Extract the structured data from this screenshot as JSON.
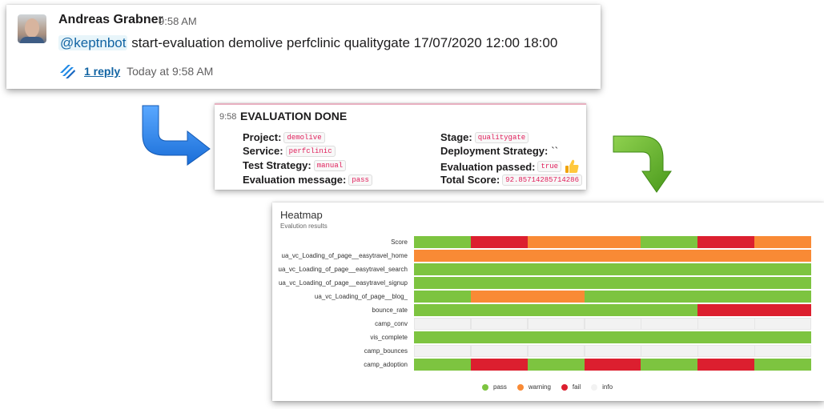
{
  "message": {
    "author": "Andreas Grabner",
    "time": "9:58 AM",
    "mention": "@keptnbot",
    "command": " start-evaluation demolive perfclinic qualitygate 17/07/2020 12:00 18:00",
    "reply_count": "1 reply",
    "reply_time": "Today at 9:58 AM"
  },
  "evaluation": {
    "time": "9:58",
    "title": "EVALUATION DONE",
    "project_label": "Project:",
    "project_value": "demolive",
    "service_label": "Service:",
    "service_value": "perfclinic",
    "test_strategy_label": "Test Strategy:",
    "test_strategy_value": "manual",
    "eval_message_label": "Evaluation message:",
    "eval_message_value": "pass",
    "stage_label": "Stage:",
    "stage_value": "qualitygate",
    "deployment_label": "Deployment Strategy:",
    "deployment_value": "``",
    "passed_label": "Evaluation passed:",
    "passed_value": "true",
    "score_label": "Total Score:",
    "score_value": "92.85714285714286"
  },
  "heatmap": {
    "title": "Heatmap",
    "subtitle": "Evalution results",
    "colors": {
      "pass": "#7dc440",
      "warning": "#f98a35",
      "fail": "#dc1f2f",
      "info": "#f2f2f2"
    },
    "legend": [
      {
        "key": "pass",
        "label": "pass"
      },
      {
        "key": "warning",
        "label": "warning"
      },
      {
        "key": "fail",
        "label": "fail"
      },
      {
        "key": "info",
        "label": "info"
      }
    ],
    "rows": [
      {
        "label": "Score",
        "cells": [
          "pass",
          "fail",
          "warning",
          "warning",
          "pass",
          "fail",
          "warning"
        ]
      },
      {
        "label": "ua_vc_Loading_of_page__easytravel_home",
        "cells": [
          "warning",
          "warning",
          "warning",
          "warning",
          "warning",
          "warning",
          "warning"
        ]
      },
      {
        "label": "ua_vc_Loading_of_page__easytravel_search",
        "cells": [
          "pass",
          "pass",
          "pass",
          "pass",
          "pass",
          "pass",
          "pass"
        ]
      },
      {
        "label": "ua_vc_Loading_of_page__easytravel_signup",
        "cells": [
          "pass",
          "pass",
          "pass",
          "pass",
          "pass",
          "pass",
          "pass"
        ]
      },
      {
        "label": "ua_vc_Loading_of_page__blog_",
        "cells": [
          "pass",
          "warning",
          "warning",
          "pass",
          "pass",
          "pass",
          "pass"
        ]
      },
      {
        "label": "bounce_rate",
        "cells": [
          "pass",
          "pass",
          "pass",
          "pass",
          "pass",
          "fail",
          "fail"
        ]
      },
      {
        "label": "camp_conv",
        "cells": [
          "info",
          "info",
          "info",
          "info",
          "info",
          "info",
          "info"
        ]
      },
      {
        "label": "vis_complete",
        "cells": [
          "pass",
          "pass",
          "pass",
          "pass",
          "pass",
          "pass",
          "pass"
        ]
      },
      {
        "label": "camp_bounces",
        "cells": [
          "info",
          "info",
          "info",
          "info",
          "info",
          "info",
          "info"
        ]
      },
      {
        "label": "camp_adoption",
        "cells": [
          "pass",
          "fail",
          "pass",
          "fail",
          "pass",
          "fail",
          "pass"
        ]
      }
    ]
  }
}
